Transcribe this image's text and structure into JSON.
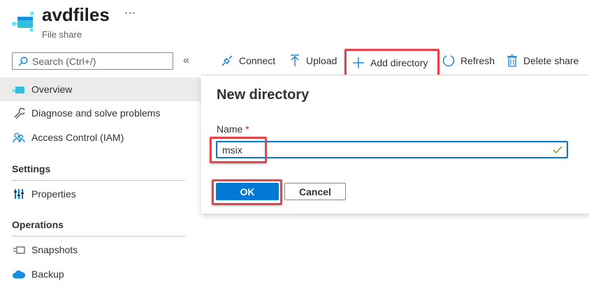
{
  "header": {
    "title": "avdfiles",
    "subtitle": "File share",
    "more": "···"
  },
  "search": {
    "placeholder": "Search (Ctrl+/)"
  },
  "collapse": "«",
  "sidebar": {
    "items": [
      {
        "label": "Overview",
        "icon": "file-share-icon",
        "selected": true
      },
      {
        "label": "Diagnose and solve problems",
        "icon": "wrench-icon"
      },
      {
        "label": "Access Control (IAM)",
        "icon": "people-icon"
      }
    ],
    "sections": [
      {
        "title": "Settings",
        "items": [
          {
            "label": "Properties",
            "icon": "properties-icon"
          }
        ]
      },
      {
        "title": "Operations",
        "items": [
          {
            "label": "Snapshots",
            "icon": "snapshots-icon"
          },
          {
            "label": "Backup",
            "icon": "backup-cloud-icon"
          }
        ]
      }
    ]
  },
  "toolbar": {
    "connect": "Connect",
    "upload": "Upload",
    "add_directory": "Add directory",
    "refresh": "Refresh",
    "delete_share": "Delete share"
  },
  "dialog": {
    "title": "New directory",
    "name_label": "Name",
    "required": "*",
    "name_value": "msix",
    "ok": "OK",
    "cancel": "Cancel"
  },
  "colors": {
    "accent": "#0078d4",
    "highlight": "#e8434c",
    "valid": "#57a300"
  }
}
